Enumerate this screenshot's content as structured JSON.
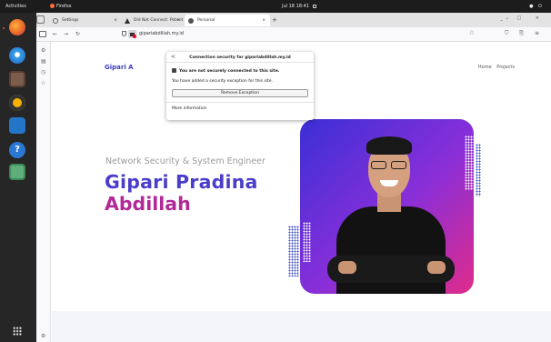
{
  "topbar": {
    "activities": "Activities",
    "app_name": "Firefox",
    "clock": "Jul 18  18:41",
    "system_icons": "● ⏻"
  },
  "browser": {
    "tabs": [
      {
        "label": "Settings",
        "close": "×"
      },
      {
        "label": "Did Not Connect: Potent",
        "close": "×"
      },
      {
        "label": "Personal",
        "close": "×"
      }
    ],
    "new_tab": "+",
    "tab_list": "⌄",
    "window_controls": "_ □ ×",
    "nav": {
      "back": "←",
      "forward": "→",
      "reload": "↻"
    },
    "url": "gipariabdillah.my.id",
    "bookmark_star": "☆",
    "right_icons": "⛉ ⎘ ≡"
  },
  "sidebar": {
    "icons": [
      "⚙",
      "▤",
      "◷",
      "☆"
    ]
  },
  "popup": {
    "title": "Connection security for gipariabdillah.my.id",
    "back": "<",
    "warning": "You are not securely connected to this site.",
    "exception_note": "You have added a security exception for this site.",
    "remove_button": "Remove Exception",
    "more_info": "More information"
  },
  "page": {
    "brand": "Gipari A",
    "nav": [
      "Home",
      "Projects"
    ],
    "subtitle": "Network Security & System Engineer",
    "name_line1": "Gipari Pradina",
    "name_line2": "Abdillah"
  },
  "colors": {
    "accent_blue": "#4a3dcc",
    "accent_magenta": "#b12896",
    "ubuntu_orange": "#e95420"
  }
}
